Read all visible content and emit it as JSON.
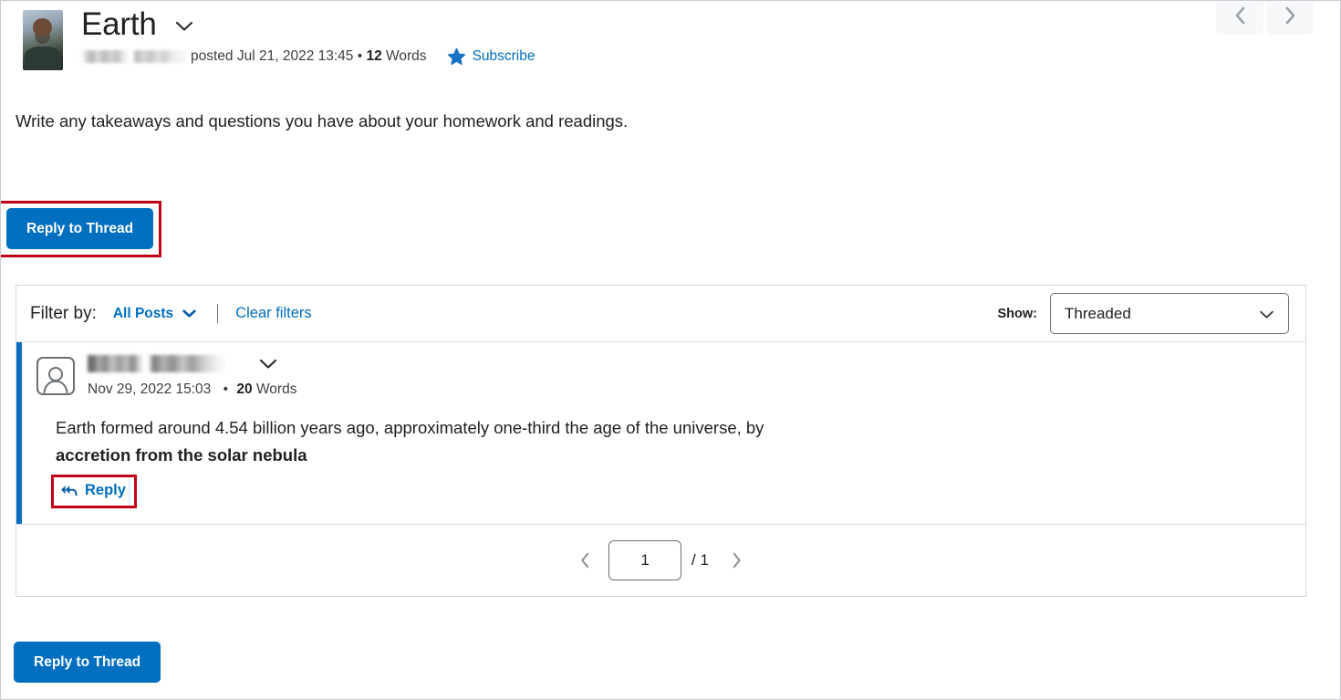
{
  "header": {
    "title": "Earth",
    "title_caret_icon": "chevron-down-icon",
    "avatar_icon": "user-photo-avatar",
    "author_name_redacted": "",
    "posted_prefix": "posted",
    "posted_date": "Jul 21, 2022 13:45",
    "bullet": "•",
    "word_count": "12",
    "word_label": "Words",
    "subscribe_label": "Subscribe",
    "subscribe_icon": "star-icon"
  },
  "topnav": {
    "prev_icon": "chevron-left-icon",
    "next_icon": "chevron-right-icon"
  },
  "prompt": {
    "text": "Write any takeaways and questions you have about your homework and readings."
  },
  "actions": {
    "reply_to_thread_top": "Reply to Thread",
    "reply_to_thread_bottom": "Reply to Thread",
    "highlight_color": "#c00418",
    "primary_color": "#006fbf"
  },
  "filter_bar": {
    "filter_label": "Filter by:",
    "filter_value": "All Posts",
    "filter_caret_icon": "chevron-down-icon",
    "divider": "|",
    "clear_filters": "Clear filters",
    "show_label": "Show:",
    "show_value": "Threaded",
    "show_caret_icon": "chevron-down-icon",
    "show_options": [
      "Threaded"
    ]
  },
  "post": {
    "avatar_icon": "person-placeholder-icon",
    "author_name_redacted": "",
    "author_caret_icon": "chevron-down-icon",
    "date": "Nov 29, 2022 15:03",
    "bullet": "•",
    "word_count": "20",
    "word_label": "Words",
    "body_part1": "Earth formed around 4.54 billion years ago, approximately one-third the age of the universe, by ",
    "body_bold": "accretion from the solar nebula",
    "reply_label": "Reply",
    "reply_icon": "reply-all-icon",
    "accent_color": "#006fbf"
  },
  "pagination": {
    "prev_icon": "chevron-left-icon",
    "next_icon": "chevron-right-icon",
    "current_page": "1",
    "total_pages": "/ 1"
  }
}
